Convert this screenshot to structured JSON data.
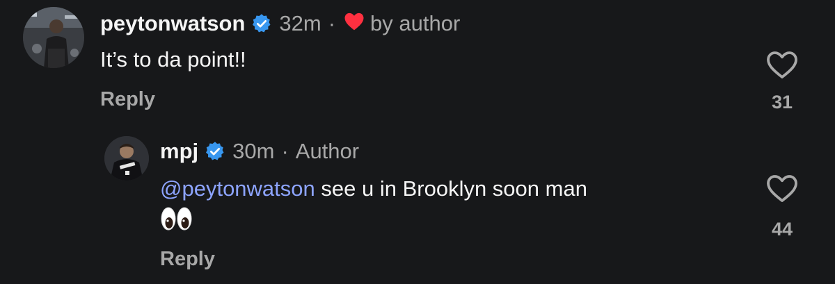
{
  "comments": [
    {
      "username": "peytonwatson",
      "verified": true,
      "time": "32m",
      "separator": "·",
      "author_like_label": "by author",
      "author_like_icon": "red-heart-icon",
      "text": "It’s to da point!!",
      "reply_label": "Reply",
      "like_count": "31"
    },
    {
      "username": "mpj",
      "verified": true,
      "time": "30m",
      "separator": "·",
      "author_badge": "Author",
      "mention": "@peytonwatson",
      "text": " see u in Brooklyn soon man",
      "emoji": "eyes-emoji",
      "reply_label": "Reply",
      "like_count": "44"
    }
  ],
  "colors": {
    "background": "#17181a",
    "primary_text": "#f5f5f5",
    "secondary_text": "#a8a8a8",
    "mention": "#8da4ff",
    "verified_blue": "#3897f0",
    "heart_red": "#ff3040"
  }
}
